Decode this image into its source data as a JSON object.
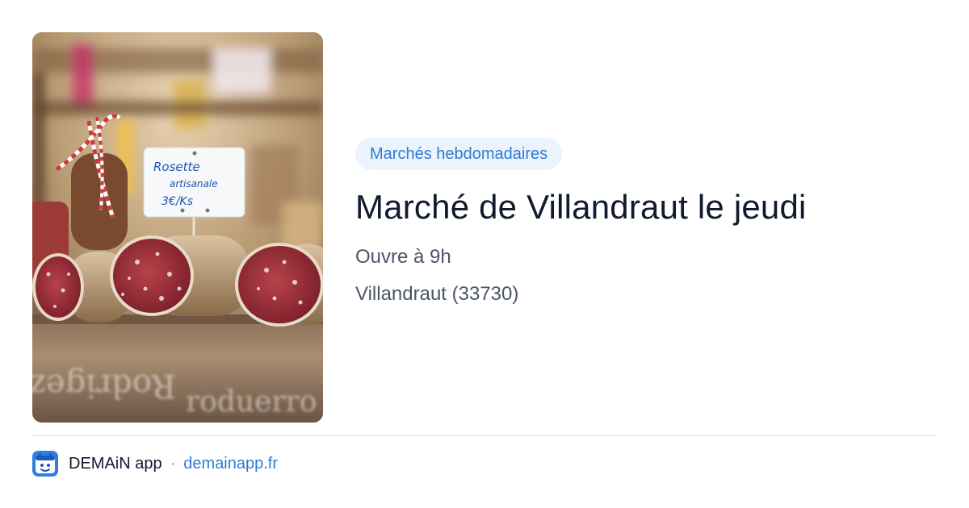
{
  "card": {
    "category": "Marchés hebdomadaires",
    "title": "Marché de Villandraut le jeudi",
    "opening_hours": "Ouvre à 9h",
    "location": "Villandraut (33730)"
  },
  "image": {
    "description_icon": "photo-saucisson-market-stall",
    "price_tag_line1": "Rosette",
    "price_tag_line2": "artisanale",
    "price_tag_line3": "3€/Ks",
    "crate_text_left": "Rodrigez",
    "crate_text_right": "roduerro"
  },
  "footer": {
    "app_name": "DEMAiN app",
    "separator": "·",
    "domain": "demainapp.fr",
    "app_icon": "demain-app-icon"
  },
  "colors": {
    "accent": "#2f7bd2",
    "badge_bg": "#ebf3fc",
    "title": "#111a2e",
    "meta": "#4a5468",
    "divider": "#dbe0e6"
  }
}
